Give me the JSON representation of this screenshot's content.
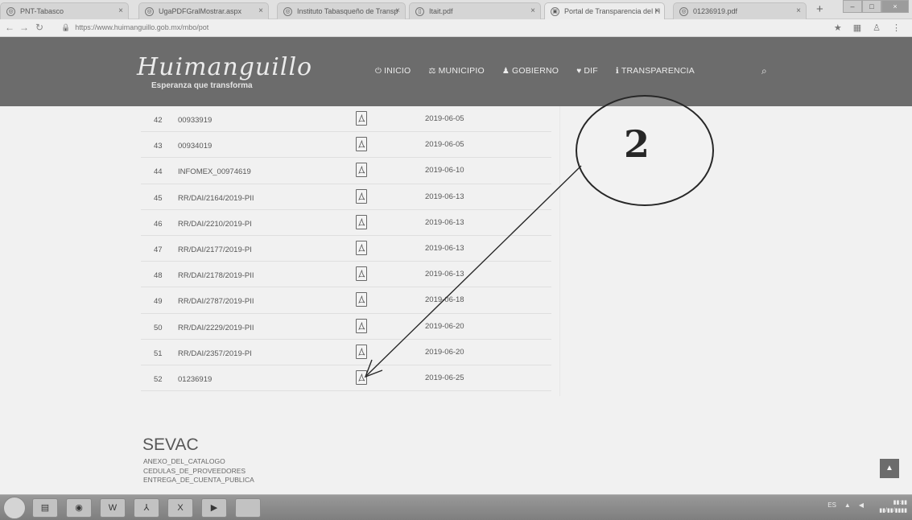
{
  "browser": {
    "tabs": [
      {
        "label": "PNT-Tabasco"
      },
      {
        "label": "UgaPDFGralMostrar.aspx"
      },
      {
        "label": "Instituto Tabasqueño de Transp"
      },
      {
        "label": "Itait.pdf"
      },
      {
        "label": "Portal de Transparencia del H"
      },
      {
        "label": "01236919.pdf"
      }
    ],
    "url": "https://www.huimanguillo.gob.mx/mbo/pot",
    "new_tab": "+"
  },
  "site": {
    "logo": "Huimanguillo",
    "tagline": "Esperanza que transforma",
    "nav": [
      {
        "icon": "power-icon",
        "glyph": "⏻",
        "label": "INICIO"
      },
      {
        "icon": "municipio-icon",
        "glyph": "⚖",
        "label": "MUNICIPIO"
      },
      {
        "icon": "gobierno-icon",
        "glyph": "♟",
        "label": "GOBIERNO"
      },
      {
        "icon": "dif-icon",
        "glyph": "♥",
        "label": "DIF"
      },
      {
        "icon": "info-icon",
        "glyph": "ℹ",
        "label": "TRANSPARENCIA"
      }
    ]
  },
  "table": {
    "rows": [
      {
        "num": "42",
        "code": "00933919",
        "date": "2019-06-05"
      },
      {
        "num": "43",
        "code": "00934019",
        "date": "2019-06-05"
      },
      {
        "num": "44",
        "code": "INFOMEX_00974619",
        "date": "2019-06-10"
      },
      {
        "num": "45",
        "code": "RR/DAI/2164/2019-PII",
        "date": "2019-06-13"
      },
      {
        "num": "46",
        "code": "RR/DAI/2210/2019-PI",
        "date": "2019-06-13"
      },
      {
        "num": "47",
        "code": "RR/DAI/2177/2019-PI",
        "date": "2019-06-13"
      },
      {
        "num": "48",
        "code": "RR/DAI/2178/2019-PII",
        "date": "2019-06-13"
      },
      {
        "num": "49",
        "code": "RR/DAI/2787/2019-PII",
        "date": "2019-06-18"
      },
      {
        "num": "50",
        "code": "RR/DAI/2229/2019-PII",
        "date": "2019-06-20"
      },
      {
        "num": "51",
        "code": "RR/DAI/2357/2019-PI",
        "date": "2019-06-20"
      },
      {
        "num": "52",
        "code": "01236919",
        "date": "2019-06-25"
      }
    ]
  },
  "annotation": {
    "label": "2"
  },
  "sevac": {
    "title": "SEVAC",
    "links": [
      "ANEXO_DEL_CATALOGO",
      "CEDULAS_DE_PROVEEDORES",
      "ENTREGA_DE_CUENTA_PUBLICA"
    ]
  },
  "taskbar": {
    "apps": [
      {
        "icon": "explorer-icon",
        "glyph": "▤"
      },
      {
        "icon": "chrome-icon",
        "glyph": "◉"
      },
      {
        "icon": "word-icon",
        "glyph": "W"
      },
      {
        "icon": "acrobat-icon",
        "glyph": "⅄"
      },
      {
        "icon": "excel-icon",
        "glyph": "X"
      },
      {
        "icon": "media-icon",
        "glyph": "▶"
      },
      {
        "icon": "blank-app-icon",
        "glyph": ""
      }
    ]
  }
}
